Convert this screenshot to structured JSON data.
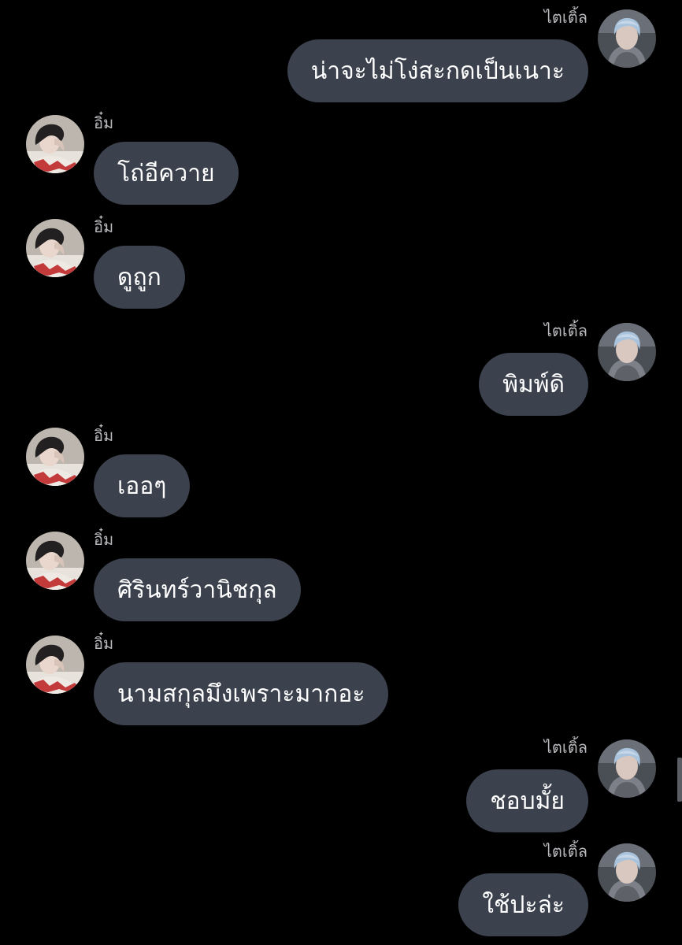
{
  "users": {
    "other": {
      "name": "อิ๋ม",
      "avatar_icon": "profile-photo-dark-hair"
    },
    "me": {
      "name": "ไตเติ้ล",
      "avatar_icon": "profile-photo-light-hair"
    }
  },
  "colors": {
    "background": "#000000",
    "bubble": "#3b414d",
    "text": "#ffffff",
    "sender_name": "#b9b9be"
  },
  "messages": [
    {
      "from": "me",
      "sender": "ไตเติ้ล",
      "text": "น่าจะไม่โง่สะกดเป็นเนาะ"
    },
    {
      "from": "other",
      "sender": "อิ๋ม",
      "text": "โถ่อีควาย"
    },
    {
      "from": "other",
      "sender": "อิ๋ม",
      "text": "ดูถูก"
    },
    {
      "from": "me",
      "sender": "ไตเติ้ล",
      "text": "พิมพ์ดิ"
    },
    {
      "from": "other",
      "sender": "อิ๋ม",
      "text": "เออๆ"
    },
    {
      "from": "other",
      "sender": "อิ๋ม",
      "text": "ศิรินทร์วานิชกุล"
    },
    {
      "from": "other",
      "sender": "อิ๋ม",
      "text": "นามสกุลมึงเพราะมากอะ"
    },
    {
      "from": "me",
      "sender": "ไตเติ้ล",
      "text": "ชอบมั้ย"
    },
    {
      "from": "me",
      "sender": "ไตเติ้ล",
      "text": "ใช้ปะล่ะ"
    }
  ]
}
